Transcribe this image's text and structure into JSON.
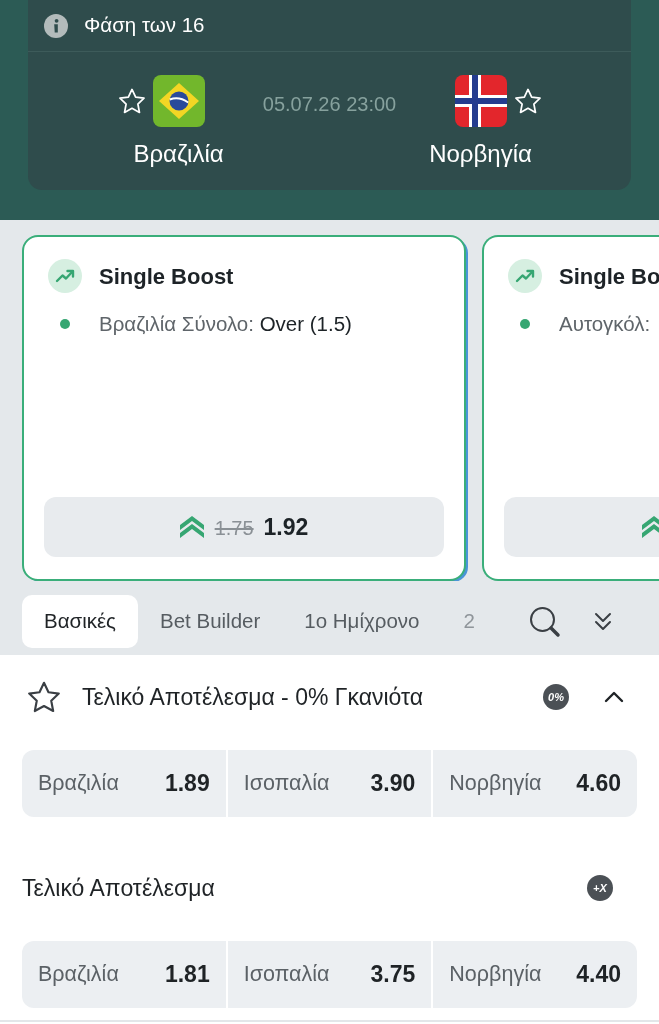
{
  "match": {
    "stage": "Φάση των 16",
    "date": "05.07.26 23:00",
    "teams": [
      {
        "name": "Βραζιλία",
        "favorite": false
      },
      {
        "name": "Νορβηγία",
        "favorite": false
      }
    ]
  },
  "boosts": [
    {
      "title": "Single Boost",
      "selection_label": "Βραζιλία Σύνολο:",
      "selection_value": "Over (1.5)",
      "old_odds": "1.75",
      "odds": "1.92"
    },
    {
      "title": "Single Bo",
      "selection_label": "Αυτογκόλ:"
    }
  ],
  "tabs": [
    {
      "label": "Βασικές",
      "selected": true
    },
    {
      "label": "Bet Builder",
      "selected": false
    },
    {
      "label": "1ο Ημίχρονο",
      "selected": false
    },
    {
      "label": "2",
      "selected": false
    }
  ],
  "markets": [
    {
      "title": "Τελικό Αποτέλεσμα - 0% Γκανιότα",
      "favorite": false,
      "badge": "0%",
      "expanded": true,
      "outcomes": [
        {
          "label": "Βραζιλία",
          "odds": "1.89"
        },
        {
          "label": "Ισοπαλία",
          "odds": "3.90"
        },
        {
          "label": "Νορβηγία",
          "odds": "4.60"
        }
      ]
    },
    {
      "title": "Τελικό Αποτέλεσμα",
      "badge": "+X",
      "outcomes": [
        {
          "label": "Βραζιλία",
          "odds": "1.81"
        },
        {
          "label": "Ισοπαλία",
          "odds": "3.75"
        },
        {
          "label": "Νορβηγία",
          "odds": "4.40"
        }
      ]
    }
  ]
}
